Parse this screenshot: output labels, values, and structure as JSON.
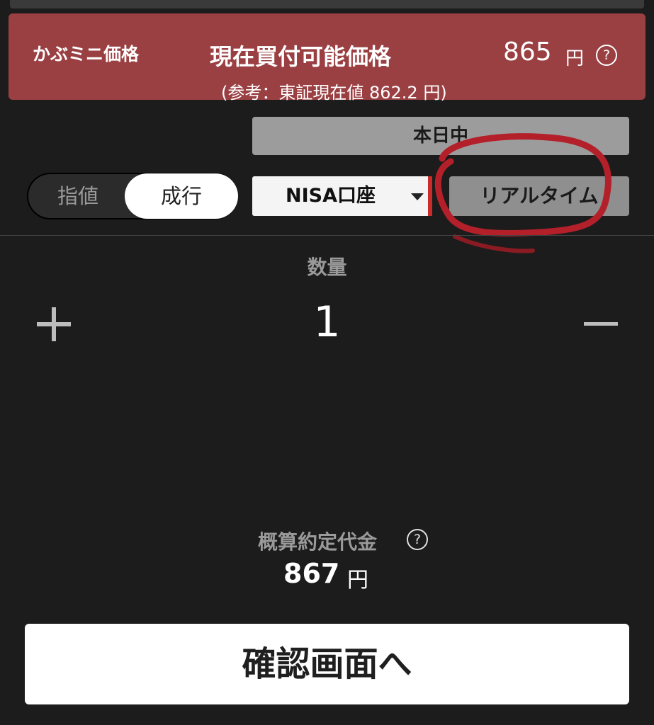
{
  "banner": {
    "mini_label": "かぶミニ価格",
    "title": "現在買付可能価格",
    "price": "865",
    "unit": "円",
    "help": "?",
    "reference": "(参考：東証現在値  862.2 円)"
  },
  "session": {
    "label": "本日中"
  },
  "order_type": {
    "options": [
      "指値",
      "成行"
    ],
    "selected": "成行"
  },
  "account": {
    "selected": "NISA口座"
  },
  "realtime": {
    "label": "リアルタイム"
  },
  "quantity": {
    "label": "数量",
    "value": "1"
  },
  "estimate": {
    "label": "概算約定代金",
    "help": "?",
    "value": "867",
    "unit": "円"
  },
  "confirm": {
    "label": "確認画面へ"
  },
  "colors": {
    "background": "#1c1c1c",
    "banner": "#9a3f42",
    "annotation": "#b3202a",
    "button": "#ffffff"
  }
}
